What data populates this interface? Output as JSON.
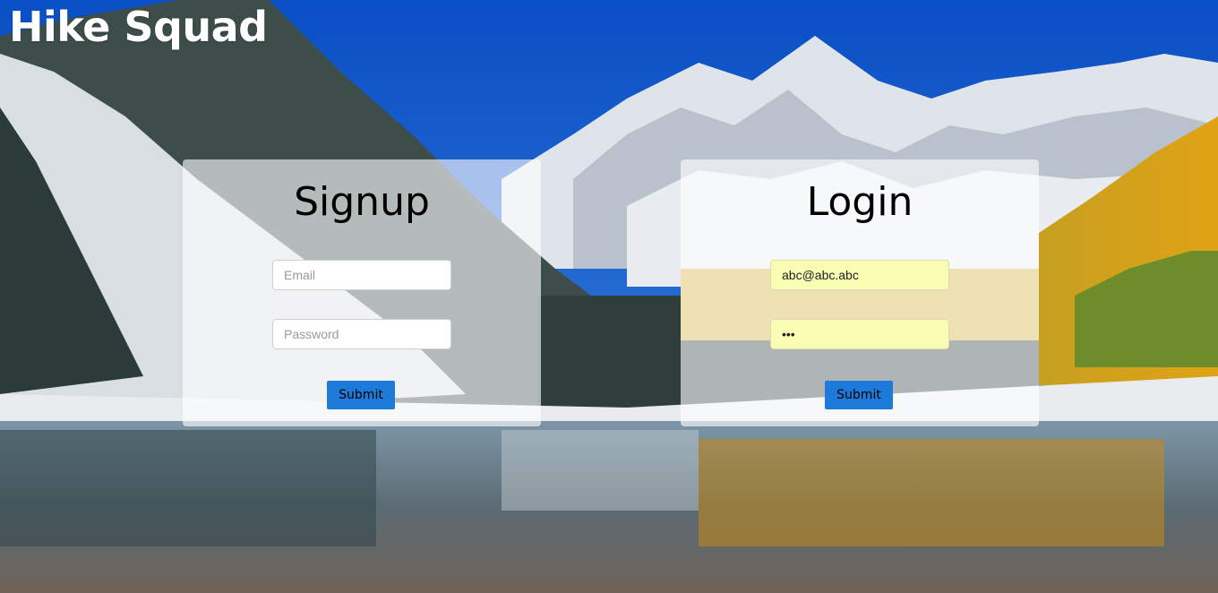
{
  "app": {
    "title": "Hike Squad"
  },
  "signup": {
    "heading": "Signup",
    "email_placeholder": "Email",
    "password_placeholder": "Password",
    "submit_label": "Submit"
  },
  "login": {
    "heading": "Login",
    "email_value": "abc@abc.abc",
    "password_value": "abc",
    "submit_label": "Submit",
    "autofill_color": "#f9fdb3"
  },
  "theme": {
    "button_color": "#1e7ad8",
    "panel_color": "#ffffff"
  }
}
